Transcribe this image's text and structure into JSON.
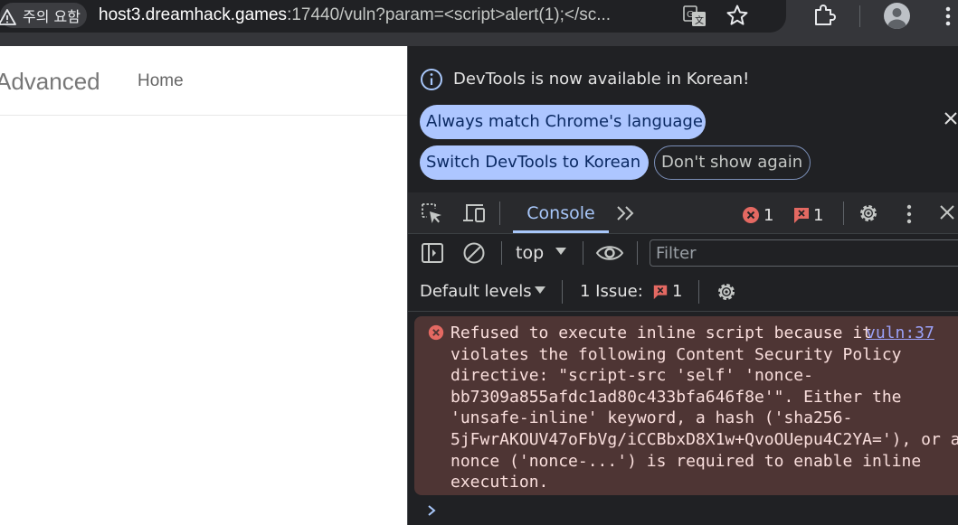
{
  "browser": {
    "security_chip": "주의 요함",
    "url_host": "host3.dreamhack.games",
    "url_rest": ":17440/vuln?param=<script>alert(1);</sc..."
  },
  "page": {
    "brand": "Advanced",
    "nav_home": "Home"
  },
  "devtools": {
    "infobar": {
      "message": "DevTools is now available in Korean!",
      "btn_always": "Always match Chrome's language",
      "btn_switch": "Switch DevTools to Korean",
      "btn_dont_show": "Don't show again"
    },
    "tabs": {
      "console": "Console"
    },
    "counts": {
      "errors": "1",
      "issues": "1"
    },
    "toolbar": {
      "context": "top",
      "filter_placeholder": "Filter",
      "levels": "Default levels",
      "issues_label": "1 Issue:",
      "issues_count": "1"
    },
    "error_message": {
      "lines": [
        "Refused to execute inline script because it",
        "violates the following Content Security Policy",
        "directive: \"script-src 'self' 'nonce-",
        "bb7309a855afdc1ad80c433bfa646f8e'\". Either the",
        "'unsafe-inline' keyword, a hash ('sha256-",
        "5jFwrAKOUV47oFbVg/iCCBbxD8X1w+QvoOUepu4C2YA='), or a",
        "nonce ('nonce-...') is required to enable inline",
        "execution."
      ],
      "source": "vuln:37"
    }
  },
  "colors": {
    "devtools_bg": "#202124",
    "accent": "#a8c7fa",
    "error_bg": "#4e3534",
    "error_icon": "#e46962",
    "pill": "#adc6ff"
  },
  "icons": [
    "warning-icon",
    "translate-icon",
    "bookmark-star-icon",
    "extensions-puzzle-icon",
    "profile-avatar",
    "info-icon",
    "close-icon",
    "inspect-element-icon",
    "device-toolbar-icon",
    "more-tabs-chevron-icon",
    "error-circle-icon",
    "issue-flag-icon",
    "gear-icon",
    "kebab-menu-icon",
    "sidebar-toggle-icon",
    "clear-console-icon",
    "eye-icon",
    "prompt-chevron-icon"
  ]
}
